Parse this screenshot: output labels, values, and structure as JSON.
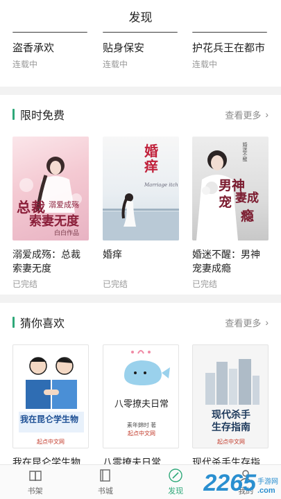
{
  "header": {
    "title": "发现"
  },
  "top_books": [
    {
      "title": "盗香承欢",
      "status": "连载中"
    },
    {
      "title": "贴身保安",
      "status": "连载中"
    },
    {
      "title": "护花兵王在都市",
      "status": "连载中"
    }
  ],
  "free": {
    "title": "限时免费",
    "more": "查看更多",
    "books": [
      {
        "title": "溺爱成殇：总裁索妻无度",
        "status": "已完结",
        "cover": {
          "line1": "总裁",
          "line2": "溺爱成殇",
          "line3": "索妻无度",
          "author": "白白",
          "suffix": "作品"
        }
      },
      {
        "title": "婚痒",
        "status": "已完结",
        "cover": {
          "main": "婚痒",
          "sub": "Marriage itch"
        }
      },
      {
        "title": "婚迷不醒：男神宠妻成瘾",
        "status": "已完结",
        "cover": {
          "top": "婚迷不醒",
          "l1": "男神",
          "l2": "宠",
          "l3": "妻成",
          "l4": "瘾"
        }
      }
    ]
  },
  "guess": {
    "title": "猜你喜欢",
    "more": "查看更多",
    "books": [
      {
        "title": "我在昆仑学生物",
        "status": "",
        "cover": {
          "text": "我在昆仑学生物",
          "publisher": "起点中文网"
        }
      },
      {
        "title": "八零撩夫日常",
        "status": "",
        "cover": {
          "text": "八零撩夫日常",
          "author": "素年錦时 著",
          "publisher": "起点中文网"
        }
      },
      {
        "title": "现代杀手生存指南",
        "status": "",
        "cover": {
          "line1": "现代杀手",
          "line2": "生存指南",
          "publisher": "起点中文网"
        }
      }
    ]
  },
  "tabs": [
    {
      "label": "书架",
      "icon": "bookshelf-icon"
    },
    {
      "label": "书城",
      "icon": "bookstore-icon"
    },
    {
      "label": "发现",
      "icon": "discover-icon",
      "active": true
    },
    {
      "label": "我的",
      "icon": "profile-icon"
    }
  ],
  "watermark": {
    "text": "2265",
    "suffix": ".com",
    "tag": "手游网"
  },
  "colors": {
    "accent": "#2ea879",
    "background": "#f2f2f2"
  }
}
